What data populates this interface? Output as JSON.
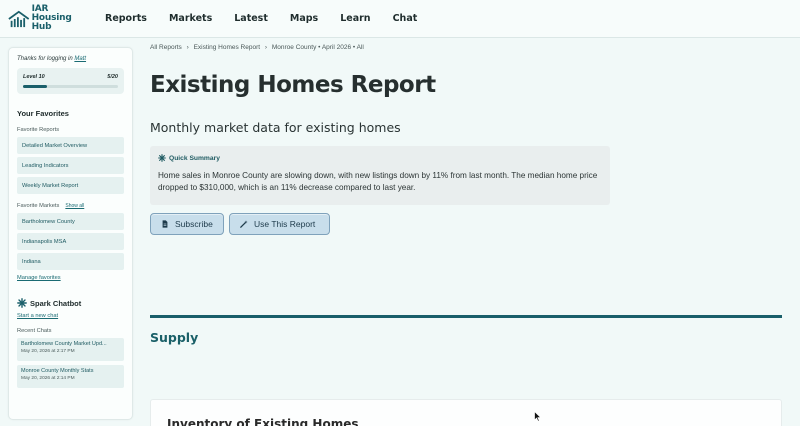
{
  "brand": {
    "logo_line1": "IAR",
    "logo_line2": "Housing Hub",
    "accent": "#1a5f6a"
  },
  "nav": {
    "items": [
      "Reports",
      "Markets",
      "Latest",
      "Maps",
      "Learn",
      "Chat"
    ]
  },
  "sidebar": {
    "thanks_prefix": "Thanks for logging in",
    "user_name": "Matt",
    "level_label": "Level 10",
    "level_progress_text": "5/20",
    "level_progress_fraction": 0.25,
    "favorites_title": "Your Favorites",
    "favorite_reports_label": "Favorite Reports",
    "favorite_reports": [
      "Detailed Market Overview",
      "Leading Indicators",
      "Weekly Market Report"
    ],
    "favorite_markets_label": "Favorite Markets",
    "show_all": "Show all",
    "favorite_markets": [
      "Bartholomew County",
      "Indianapolis MSA",
      "Indiana"
    ],
    "manage_favorites": "Manage favorites",
    "chatbot_title": "Spark Chatbot",
    "new_chat": "Start a new chat",
    "recent_chats_label": "Recent Chats",
    "recent_chats": [
      {
        "title": "Bartholomew County Market Upd...",
        "date": "May 20, 2026 at 2:17 PM"
      },
      {
        "title": "Monroe County Monthly Stats",
        "date": "May 20, 2026 at 2:14 PM"
      }
    ]
  },
  "breadcrumb": {
    "items": [
      "All Reports",
      "›",
      "Existing Homes Report",
      "›",
      "Monroe County • April 2026 • All"
    ]
  },
  "main": {
    "title": "Existing Homes Report",
    "subtitle": "Monthly market data for existing homes",
    "summary_label": "Quick Summary",
    "summary_text": "Home sales in Monroe County are slowing down, with new listings down by 11% from last month. The median home price dropped to $310,000, which is an 11% decrease compared to last year.",
    "subscribe_label": "Subscribe",
    "use_report_label": "Use This Report",
    "section_title": "Supply",
    "card_title": "Inventory of Existing Homes"
  }
}
